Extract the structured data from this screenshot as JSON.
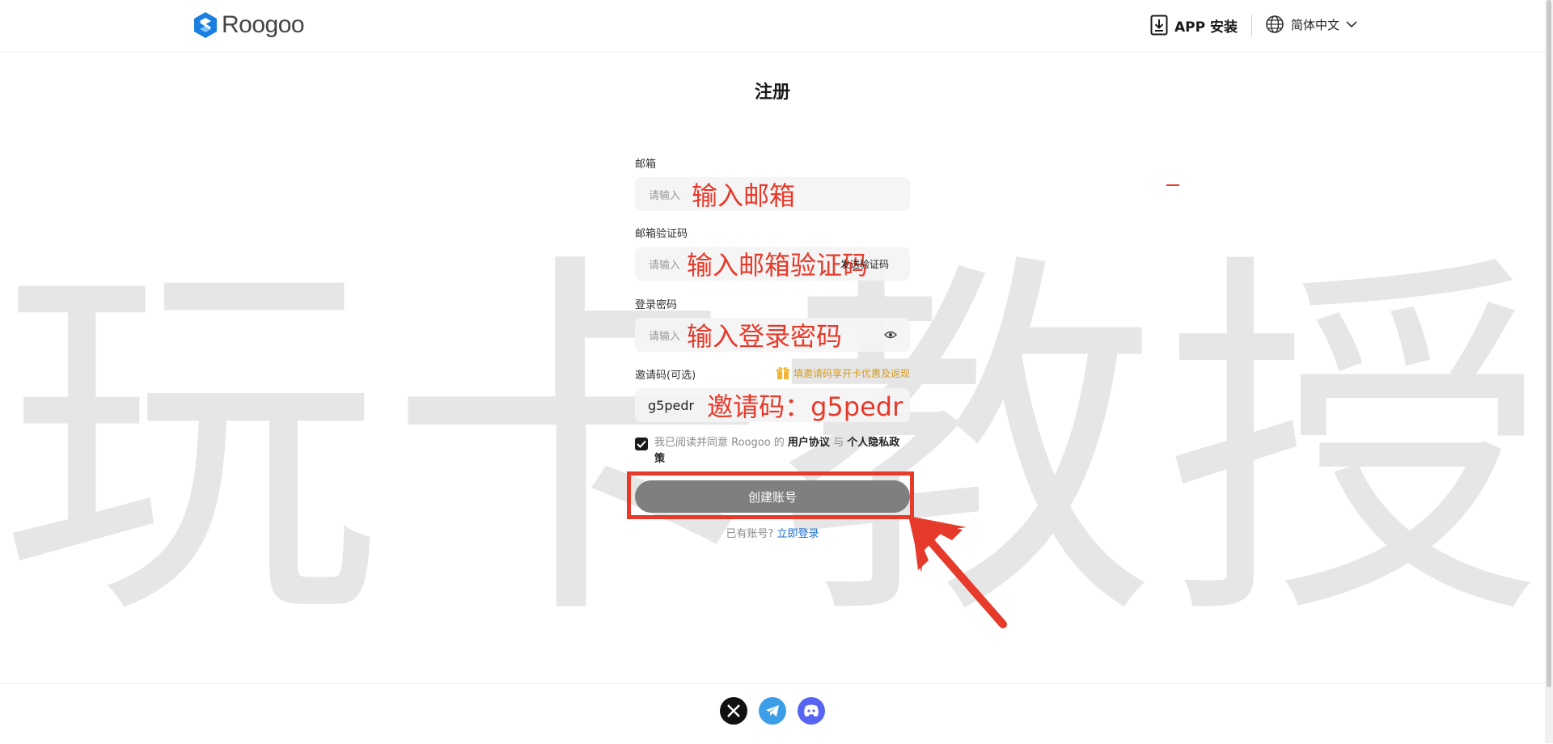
{
  "header": {
    "logo_text": "Roogoo",
    "app_install_label": "APP 安装",
    "language_label": "简体中文"
  },
  "watermark": [
    "玩",
    "卡",
    "教",
    "授"
  ],
  "page": {
    "title": "注册"
  },
  "form": {
    "email": {
      "label": "邮箱",
      "placeholder": "请输入",
      "annotation": "输入邮箱"
    },
    "email_code": {
      "label": "邮箱验证码",
      "placeholder": "请输入",
      "annotation": "输入邮箱验证码",
      "send_label": "发送验证码"
    },
    "password": {
      "label": "登录密码",
      "placeholder": "请输入",
      "annotation": "输入登录密码"
    },
    "invite": {
      "label": "邀请码(可选)",
      "value": "g5pedr",
      "annotation": "邀请码：g5pedr",
      "promo": "填邀请码享开卡优惠及返现"
    },
    "agreement": {
      "prefix": "我已阅读并同意 Roogoo 的 ",
      "user_agreement": "用户协议",
      "and": " 与 ",
      "privacy_policy": "个人隐私政策"
    },
    "create_button": "创建账号",
    "have_account": "已有账号?",
    "login_now": "立即登录"
  },
  "footer": {
    "socials": [
      "x-icon",
      "telegram-icon",
      "discord-icon"
    ]
  },
  "colors": {
    "annotation": "#e63a2b",
    "button": "#7f7f7f",
    "link": "#1a6fd1",
    "promo": "#d79a1a",
    "telegram": "#3d9ee8",
    "discord": "#5865f2"
  }
}
